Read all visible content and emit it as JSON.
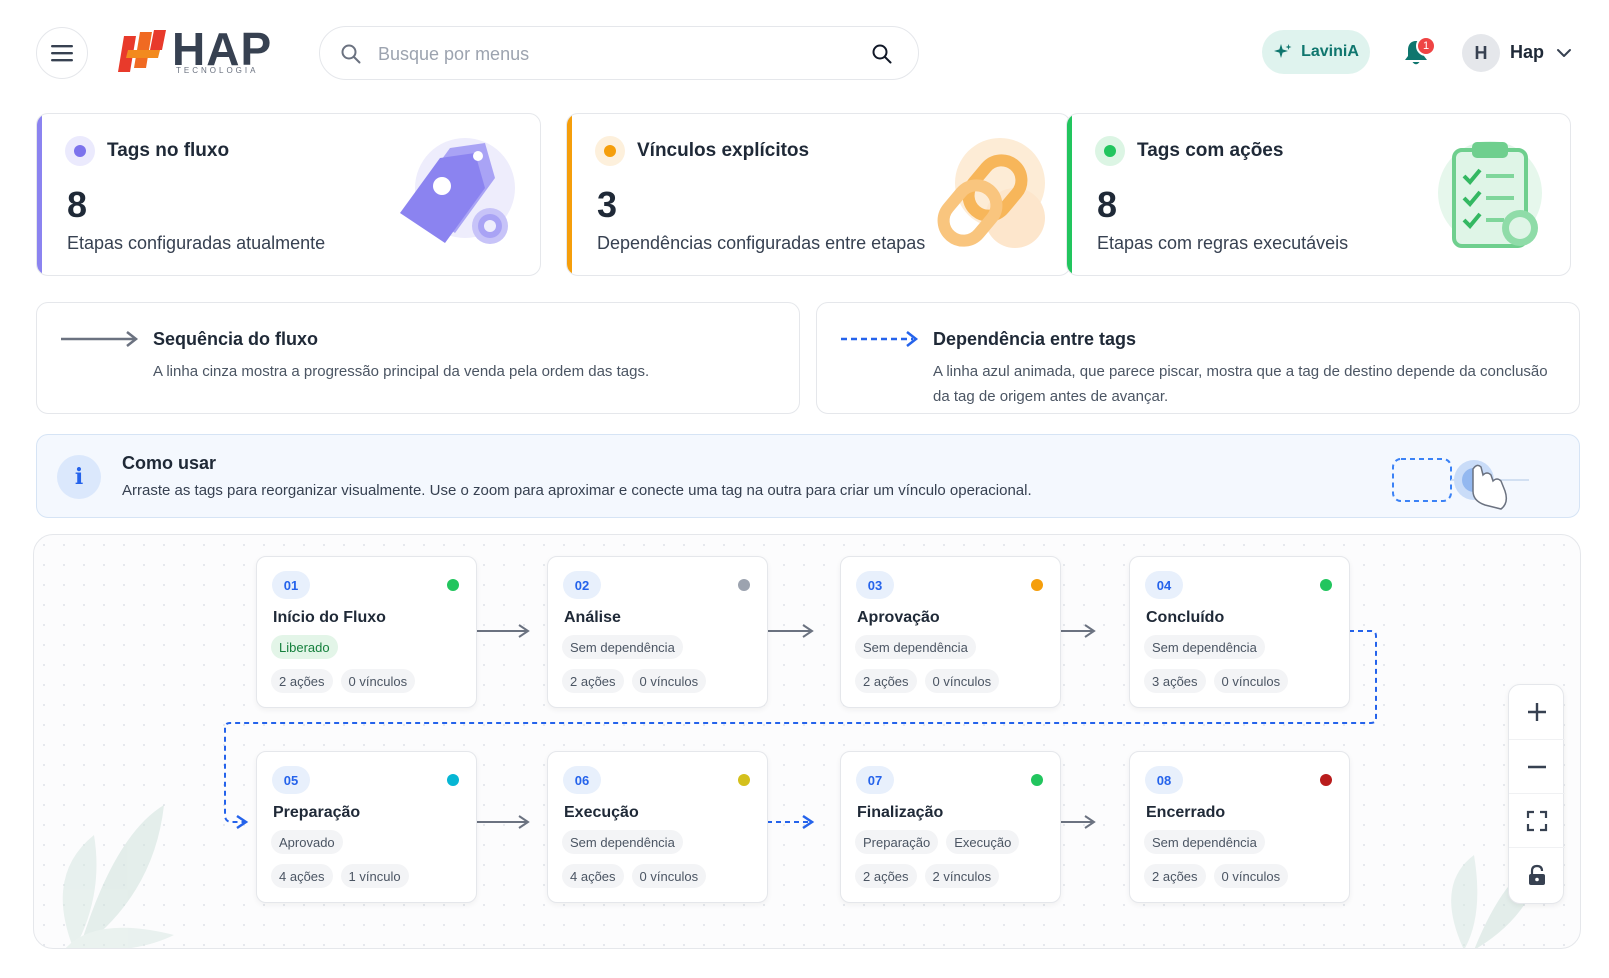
{
  "header": {
    "menu_icon": "hamburger-icon",
    "logo_text": "HAP",
    "logo_subtext": "TECNOLOGIA",
    "search_placeholder": "Busque por menus",
    "assistant_label": "LaviniA",
    "notification_count": "1",
    "user_initial": "H",
    "user_name": "Hap"
  },
  "stats": [
    {
      "title": "Tags no fluxo",
      "value": "8",
      "description": "Etapas configuradas atualmente",
      "accent": "#8b83f0",
      "illustration": "tags-gear-icon"
    },
    {
      "title": "Vínculos explícitos",
      "value": "3",
      "description": "Dependências configuradas entre etapas",
      "accent": "#f59e0b",
      "illustration": "chain-link-icon"
    },
    {
      "title": "Tags com ações",
      "value": "8",
      "description": "Etapas com regras executáveis",
      "accent": "#22c55e",
      "illustration": "clipboard-check-icon"
    }
  ],
  "legend": {
    "sequence": {
      "title": "Sequência do fluxo",
      "description": "A linha cinza mostra a progressão principal da venda pela ordem das tags."
    },
    "dependency": {
      "title": "Dependência entre tags",
      "description": "A linha azul animada, que parece piscar, mostra que a tag de destino depende da conclusão da tag de origem antes de avançar."
    }
  },
  "info": {
    "title": "Como usar",
    "description": "Arraste as tags para reorganizar visualmente. Use o zoom para aproximar e conecte uma tag na outra para criar um vínculo operacional."
  },
  "nodes": [
    {
      "num": "01",
      "title": "Início do Fluxo",
      "status_color": "#22c55e",
      "chips": [
        {
          "label": "Liberado",
          "style": "green"
        }
      ],
      "actions": "2 ações",
      "links": "0 vínculos"
    },
    {
      "num": "02",
      "title": "Análise",
      "status_color": "#9ca3af",
      "chips": [
        {
          "label": "Sem dependência",
          "style": "gray"
        }
      ],
      "actions": "2 ações",
      "links": "0 vínculos"
    },
    {
      "num": "03",
      "title": "Aprovação",
      "status_color": "#f59e0b",
      "chips": [
        {
          "label": "Sem dependência",
          "style": "gray"
        }
      ],
      "actions": "2 ações",
      "links": "0 vínculos"
    },
    {
      "num": "04",
      "title": "Concluído",
      "status_color": "#22c55e",
      "chips": [
        {
          "label": "Sem dependência",
          "style": "gray"
        }
      ],
      "actions": "3 ações",
      "links": "0 vínculos"
    },
    {
      "num": "05",
      "title": "Preparação",
      "status_color": "#06b6d4",
      "chips": [
        {
          "label": "Aprovado",
          "style": "gray"
        }
      ],
      "actions": "4 ações",
      "links": "1 vínculo"
    },
    {
      "num": "06",
      "title": "Execução",
      "status_color": "#d4c01c",
      "chips": [
        {
          "label": "Sem dependência",
          "style": "gray"
        }
      ],
      "actions": "4 ações",
      "links": "0 vínculos"
    },
    {
      "num": "07",
      "title": "Finalização",
      "status_color": "#22c55e",
      "chips": [
        {
          "label": "Preparação",
          "style": "gray"
        },
        {
          "label": "Execução",
          "style": "gray"
        }
      ],
      "actions": "2 ações",
      "links": "2 vínculos"
    },
    {
      "num": "08",
      "title": "Encerrado",
      "status_color": "#b91c1c",
      "chips": [
        {
          "label": "Sem dependência",
          "style": "gray"
        }
      ],
      "actions": "2 ações",
      "links": "0 vínculos"
    }
  ],
  "zoom_controls": [
    "zoom-in-icon",
    "zoom-out-icon",
    "fit-view-icon",
    "lock-icon"
  ],
  "colors": {
    "sequence_line": "#6b7280",
    "dependency_line": "#2563eb",
    "accent_teal": "#0f766e"
  }
}
